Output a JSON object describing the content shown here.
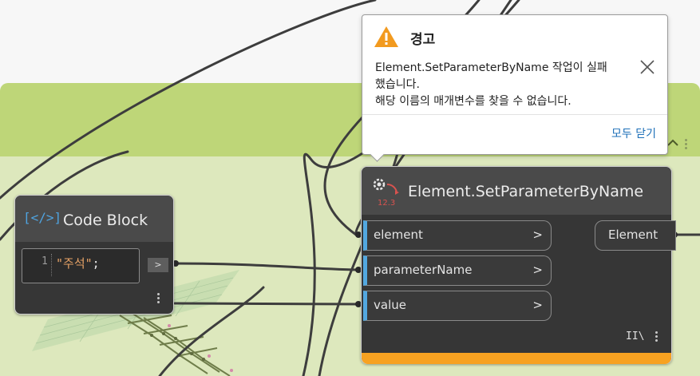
{
  "warning": {
    "title": "경고",
    "message_line1": "Element.SetParameterByName 작업이 실패",
    "message_line2": "했습니다.",
    "message_line3": "해당 이름의 매개변수를 찾을 수 없습니다.",
    "close_all": "모두 닫기"
  },
  "code_block": {
    "title": "Code Block",
    "icon_text": "[</>]",
    "line_number": "1",
    "code_string": "\"주석\"",
    "code_punct": ";",
    "output_label": ">"
  },
  "set_param_node": {
    "title": "Element.SetParameterByName",
    "icon_badge": "12.3",
    "inputs": [
      {
        "label": "element",
        "arrow": ">"
      },
      {
        "label": "parameterName",
        "arrow": ">"
      },
      {
        "label": "value",
        "arrow": ">"
      }
    ],
    "output": "Element",
    "lacing": "II\\"
  },
  "colors": {
    "group_header": "#bed678",
    "group_body": "#dde8bd",
    "node_bg": "#363636",
    "port_accent": "#52a8e0",
    "warning_bar": "#f7a221",
    "warning_icon": "#f29a1f",
    "link": "#1c6fb8"
  }
}
